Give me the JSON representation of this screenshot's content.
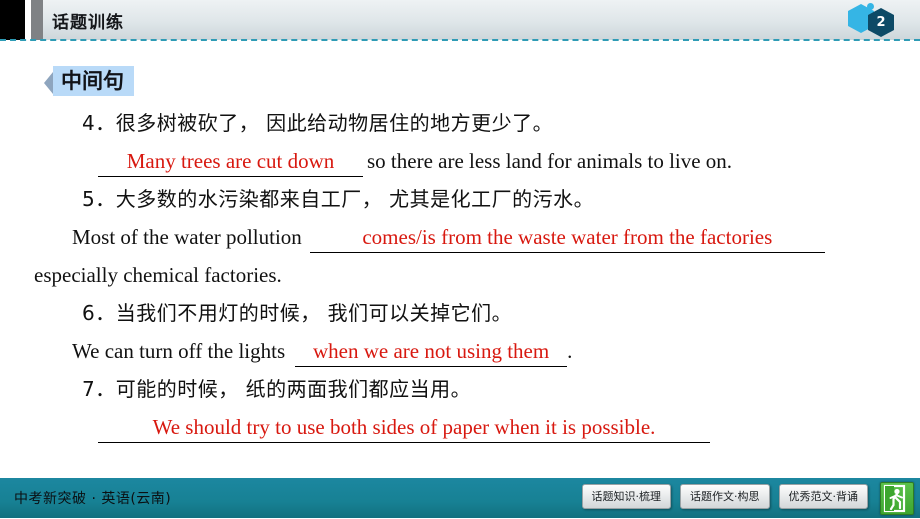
{
  "header": {
    "title": "话题训练",
    "badge_number": "2"
  },
  "section": {
    "label": "中间句"
  },
  "items": [
    {
      "number": "4",
      "chinese": "4．很多树被砍了， 因此给动物居住的地方更少了。",
      "answer_red": "Many trees are cut down",
      "tail_black": "so there are less land for animals to live on."
    },
    {
      "number": "5",
      "chinese": "5．大多数的水污染都来自工厂， 尤其是化工厂的污水。",
      "lead_black": "Most  of  the  water  pollution",
      "answer_red": "comes/is from the waste water from the factories",
      "continuation": "especially chemical factories."
    },
    {
      "number": "6",
      "chinese": "6．当我们不用灯的时候， 我们可以关掉它们。",
      "lead_black": "We can turn off the lights",
      "answer_red": "when we are not using them",
      "period": "."
    },
    {
      "number": "7",
      "chinese": "7．可能的时候， 纸的两面我们都应当用。",
      "answer_red": "We should try to use both sides of paper when it is possible."
    }
  ],
  "footer": {
    "title": "中考新突破 · 英语(云南)",
    "buttons": [
      "话题知识·梳理",
      "话题作文·构思",
      "优秀范文·背诵"
    ],
    "exit_icon": "exit-running-figure"
  },
  "colors": {
    "answer_red": "#d8180f",
    "footer_teal": "#1a8095",
    "badge_blue": "#b9daf8",
    "dashed_line": "#2e9bb5",
    "hex_light": "#35b5e5",
    "hex_dark": "#0d4a66"
  }
}
